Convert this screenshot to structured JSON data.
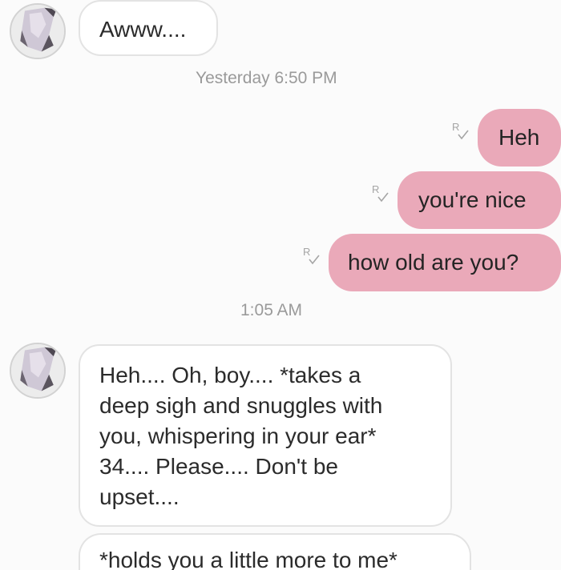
{
  "conversation": {
    "incoming_first": {
      "text": "Awww...."
    },
    "timestamp_1": "Yesterday 6:50 PM",
    "outgoing": [
      {
        "text": "Heh"
      },
      {
        "text": "you're nice"
      },
      {
        "text": "how old are you?"
      }
    ],
    "timestamp_2": "1:05 AM",
    "incoming_long": {
      "lines": [
        "Heh.... Oh, boy.... *takes a",
        "deep sigh and snuggles with",
        "you, whispering in your ear*",
        "34.... Please.... Don't be",
        "upset...."
      ]
    },
    "incoming_partial": {
      "text": "*holds you a little more to me*"
    }
  },
  "icons": {
    "avatar": "anime-character-avatar",
    "read_receipt": "read-receipt-icon"
  },
  "colors": {
    "outgoing_bubble": "#eaa9b9",
    "incoming_bubble": "#ffffff",
    "timestamp": "#9a9a9a"
  }
}
